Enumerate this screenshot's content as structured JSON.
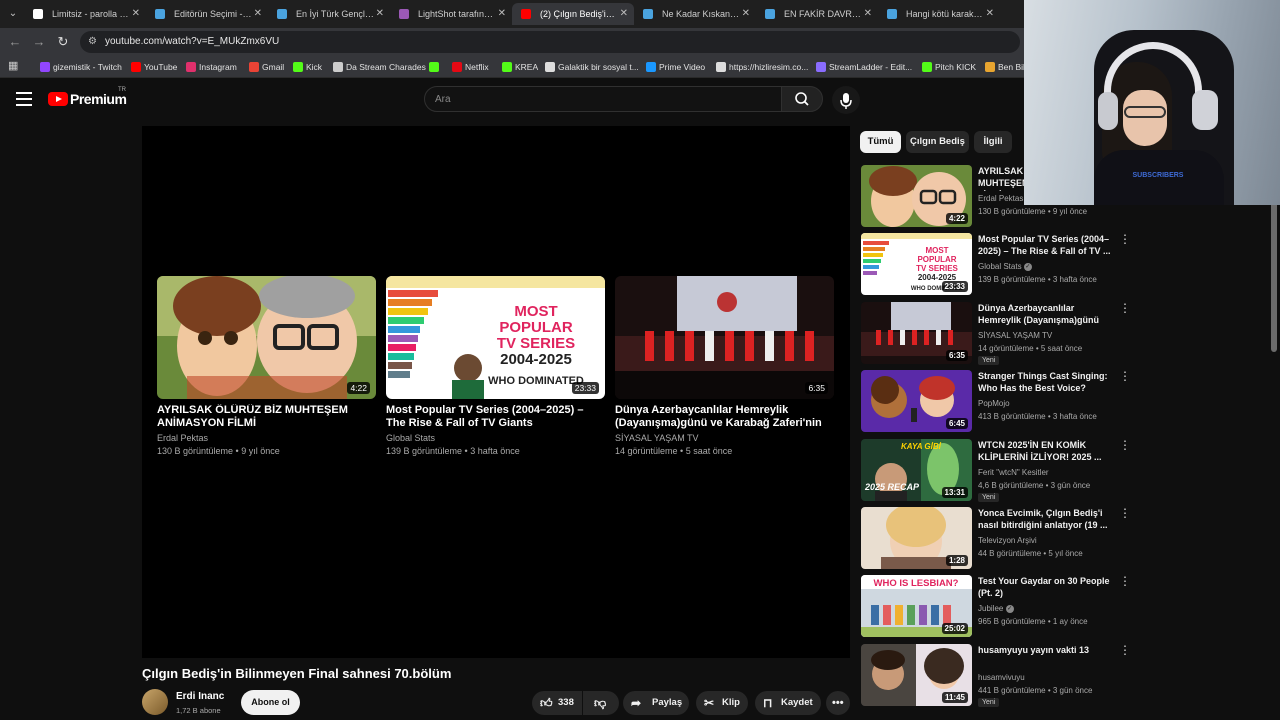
{
  "browser": {
    "tabs": [
      {
        "title": "Limitsiz - parolla - Ke",
        "color": "#ffffff"
      },
      {
        "title": "Editörün Seçimi - Tur",
        "color": "#4aa3df"
      },
      {
        "title": "En İyi Türk Gençlik Di",
        "color": "#4aa3df"
      },
      {
        "title": "LightShot tarafından",
        "color": "#9b59b6"
      },
      {
        "title": "(2) Çılgın Bediş'in Bili",
        "color": "#ff0000"
      },
      {
        "title": "Ne Kadar Kıskançsın",
        "color": "#4aa3df"
      },
      {
        "title": "EN FAKİR DAVRANIŞ",
        "color": "#4aa3df"
      },
      {
        "title": "Hangi kötü karakter",
        "color": "#4aa3df"
      }
    ],
    "url": "youtube.com/watch?v=E_MUkZmx6VU",
    "bookmarks": [
      {
        "label": "gizemistik - Twitch",
        "color": "#9146ff"
      },
      {
        "label": "YouTube",
        "color": "#ff0000"
      },
      {
        "label": "Instagram",
        "color": "#e1306c"
      },
      {
        "label": "Gmail",
        "color": "#ea4335"
      },
      {
        "label": "Kick",
        "color": "#53fc18"
      },
      {
        "label": "Da Stream Charades",
        "color": "#cccccc"
      },
      {
        "label": "",
        "color": "#53fc18"
      },
      {
        "label": "Netflix",
        "color": "#e50914"
      },
      {
        "label": "KREA",
        "color": "#53fc18"
      },
      {
        "label": "Galaktik bir sosyal t...",
        "color": "#dddddd"
      },
      {
        "label": "Prime Video",
        "color": "#1a98ff"
      },
      {
        "label": "https://hizliresim.co...",
        "color": "#dddddd"
      },
      {
        "label": "StreamLadder - Edit...",
        "color": "#8a6cff"
      },
      {
        "label": "Pitch KICK",
        "color": "#53fc18"
      },
      {
        "label": "Ben Bild",
        "color": "#e8a530"
      }
    ]
  },
  "header": {
    "logo_text": "Premium",
    "logo_region": "TR",
    "search_placeholder": "Ara"
  },
  "end_screen": [
    {
      "title": "AYRILSAK ÖLÜRÜZ BİZ MUHTEŞEM ANİMASYON FİLMİ",
      "channel": "Erdal Pektas",
      "meta": "130 B görüntüleme • 9 yıl önce",
      "duration": "4:22"
    },
    {
      "title": "Most Popular TV Series (2004–2025) – The Rise & Fall of TV Giants",
      "channel": "Global Stats",
      "meta": "139 B görüntüleme • 3 hafta önce",
      "duration": "23:33"
    },
    {
      "title": "Dünya Azerbaycanlılar Hemreylik (Dayanışma)günü ve Karabağ Zaferi'nin 5....",
      "channel": "SİYASAL YAŞAM TV",
      "meta": "14 görüntüleme • 5 saat önce",
      "duration": "6:35"
    }
  ],
  "video": {
    "title": "Çılgın Bediş'in Bilinmeyen Final sahnesi 70.bölüm",
    "channel": "Erdi Inanc",
    "subscribers": "1,72 B abone",
    "subscribe_label": "Abone ol",
    "likes": "338",
    "share_label": "Paylaş",
    "clip_label": "Klip",
    "save_label": "Kaydet"
  },
  "chips": [
    "Tümü",
    "Çılgın Bediş",
    "İlgili"
  ],
  "recommendations": [
    {
      "title": "AYRILSAK ÖLÜRÜZ BİZ MUHTEŞEM ANİMASYON FİLMİ",
      "channel": "Erdal Pektas",
      "meta": "130 B görüntüleme • 9 yıl önce",
      "duration": "4:22",
      "badge": "",
      "verified": false
    },
    {
      "title": "Most Popular TV Series (2004–2025) – The Rise & Fall of TV ...",
      "channel": "Global Stats",
      "meta": "139 B görüntüleme • 3 hafta önce",
      "duration": "23:33",
      "badge": "",
      "verified": true
    },
    {
      "title": "Dünya Azerbaycanlılar Hemreylik (Dayanışma)günü v...",
      "channel": "SİYASAL YAŞAM TV",
      "meta": "14 görüntüleme • 5 saat önce",
      "duration": "6:35",
      "badge": "Yeni",
      "verified": false
    },
    {
      "title": "Stranger Things Cast Singing: Who Has the Best Voice?",
      "channel": "PopMojo",
      "meta": "413 B görüntüleme • 3 hafta önce",
      "duration": "6:45",
      "badge": "",
      "verified": false
    },
    {
      "title": "WTCN 2025'İN EN KOMİK KLİPLERİNİ İZLİYOR! 2025 ...",
      "channel": "Ferit \"wtcN\" Kesitler",
      "meta": "4,6 B görüntüleme • 3 gün önce",
      "duration": "13:31",
      "badge": "Yeni",
      "verified": false
    },
    {
      "title": "Yonca Evcimik, Çılgın Bediş'i nasıl bitirdiğini anlatıyor (19 ...",
      "channel": "Televizyon Arşivi",
      "meta": "44 B görüntüleme • 5 yıl önce",
      "duration": "1:28",
      "badge": "",
      "verified": false
    },
    {
      "title": "Test Your Gaydar on 30 People (Pt. 2)",
      "channel": "Jubilee",
      "meta": "965 B görüntüleme • 1 ay önce",
      "duration": "25:02",
      "badge": "",
      "verified": true
    },
    {
      "title": "husamyuyu yayın vakti 13",
      "channel": "husamvivuyu",
      "meta": "441 B görüntüleme • 3 gün önce",
      "duration": "11:45",
      "badge": "Yeni",
      "verified": false
    }
  ],
  "thumb_text": {
    "tv_line1": "MOST",
    "tv_line2": "POPULAR",
    "tv_line3": "TV SERIES",
    "tv_line4": "2004-2025",
    "tv_line5": "WHO DOMINATED",
    "recap": "2025 RECAP",
    "kaya": "KAYA GİBİ",
    "lesbian": "WHO IS LESBIAN?"
  },
  "webcam": {
    "shirt_text": "SUBSCRIBERS"
  }
}
